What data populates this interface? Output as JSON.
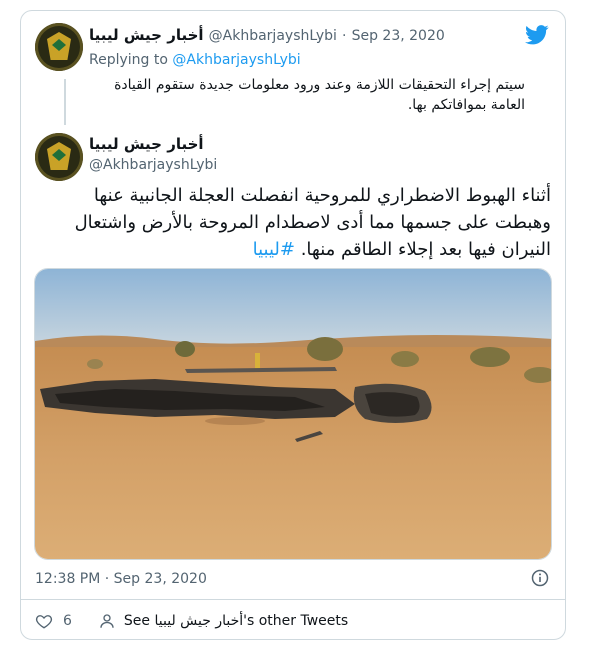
{
  "parent_tweet": {
    "display_name": "أخبار جيش ليبيا",
    "handle": "@AkhbarjayshLybi",
    "separator": "·",
    "date": "Sep 23, 2020",
    "replying_prefix": "Replying to ",
    "replying_handle": "@AkhbarjayshLybi",
    "text": "سيتم إجراء التحقيقات اللازمة وعند ورود معلومات جديدة ستقوم القيادة العامة بموافاتكم بها."
  },
  "main_tweet": {
    "display_name": "أخبار جيش ليبيا",
    "handle": "@AkhbarjayshLybi",
    "text": "أثناء الهبوط الاضطراري للمروحية انفصلت العجلة الجانبية عنها وهبطت على جسمها مما أدى لاصطدام المروحة بالأرض واشتعال النيران فيها بعد إجلاء الطاقم منها. ",
    "hashtag": "#ليبيا",
    "timestamp": "12:38 PM · Sep 23, 2020",
    "like_count": "6",
    "see_other_tweets": "See أخبار جيش ليبيا's other Tweets"
  },
  "media": {
    "description_icon": "photo"
  },
  "colors": {
    "accent": "#1d9bf0",
    "text": "#0f1419",
    "muted": "#536471",
    "border": "#cfd9de"
  },
  "icons": [
    "twitter-bird-icon",
    "info-icon",
    "heart-icon",
    "person-icon"
  ]
}
